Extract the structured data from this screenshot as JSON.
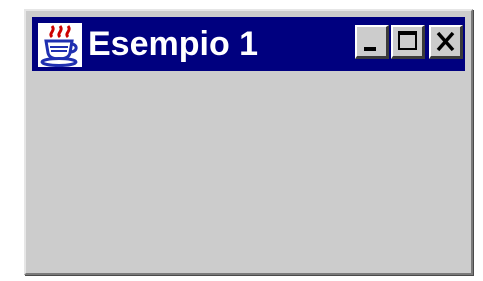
{
  "window": {
    "title": "Esempio 1",
    "icon": "java-coffee-cup-icon",
    "controls": [
      {
        "name": "minimize-button",
        "icon": "minimize-icon",
        "glyph": "_"
      },
      {
        "name": "maximize-button",
        "icon": "maximize-icon",
        "glyph": "□"
      },
      {
        "name": "close-button",
        "icon": "close-icon",
        "glyph": "X"
      }
    ]
  },
  "colors": {
    "titlebar": "#00007f",
    "title_text": "#ffffff",
    "window_face": "#cccccc",
    "icon_red": "#cc0000",
    "icon_blue": "#1f2fb0"
  }
}
